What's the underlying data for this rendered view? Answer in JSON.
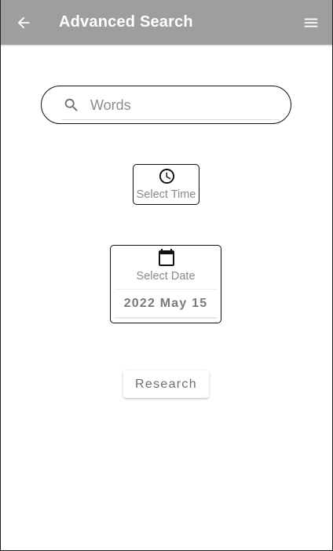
{
  "app_bar": {
    "title": "Advanced Search",
    "background_color": "#9e9e9e",
    "text_color": "#ffffff",
    "back_icon": "arrow-left-icon",
    "menu_icon": "hamburger-menu-icon"
  },
  "search": {
    "placeholder": "Words",
    "value": "",
    "icon": "search-icon"
  },
  "time_picker": {
    "label": "Select Time",
    "icon": "clock-icon"
  },
  "date_picker": {
    "label": "Select Date",
    "value": "2022 May 15",
    "icon": "calendar-icon"
  },
  "actions": {
    "research_label": "Research"
  }
}
